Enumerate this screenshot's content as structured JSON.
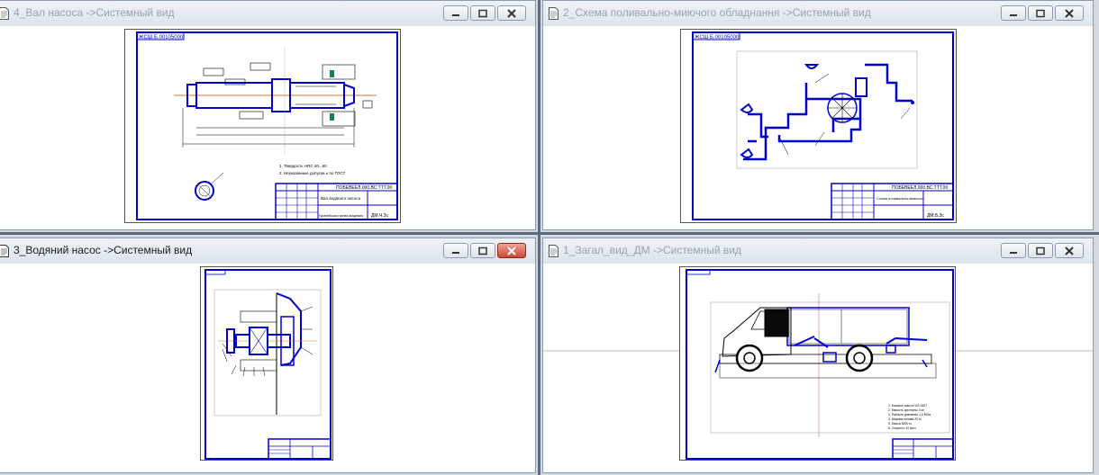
{
  "windows": [
    {
      "id": "w4",
      "title": "4_Вал насоса ->Системный вид",
      "active": false
    },
    {
      "id": "w2",
      "title": "2_Схема поливально-миючого обладнання ->Системный вид",
      "active": false
    },
    {
      "id": "w3",
      "title": "3_Водяний насос ->Системный вид",
      "active": true
    },
    {
      "id": "w1",
      "title": "1_Загал_вид_ДМ ->Системный вид",
      "active": false
    }
  ],
  "drawings": {
    "shaft": {
      "stamp_code": "ЖСШ.Б.00105000.",
      "title_code": "ПОБЕВЕЕЛ.000.ВС.ТТТ.00",
      "title_name": "Вал водяного насоса",
      "org": "Гуралейская горная академия",
      "group": "ДМ.Ч.3с",
      "notes_1": "1. Твердость НRC 40...50",
      "notes_2": "2. Неуказанные допуски ± по ГОСТ"
    },
    "scheme": {
      "stamp_code": "ЖСШ.Б.00105000.",
      "title_code": "ПОБЕВЕЕЛ.000.ВС.ТТТ.00",
      "title_name": "Схема поливально-миючого",
      "group": "ДМ.Б.3с"
    },
    "truck": {
      "notes": [
        "1. Базовое шасси ГАЗ-3307",
        "2. Емкость цистерны 4 м³",
        "3. Рабочее давление 1,0 МПа",
        "4. Ширина полива 20 м",
        "5. Масса 6200 кг",
        "6. Скорость 10 км/ч"
      ]
    }
  },
  "colors": {
    "frame": "#0000cc",
    "line": "#000000",
    "axis": "#d27a2a",
    "accent": "#1e7a5a"
  }
}
